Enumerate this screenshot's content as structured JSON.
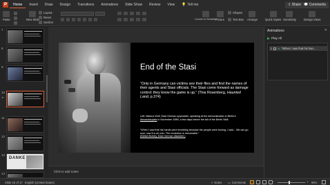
{
  "menubar": {
    "items": [
      "Home",
      "Insert",
      "Draw",
      "Design",
      "Transitions",
      "Animations",
      "Slide Show",
      "Review",
      "View"
    ],
    "active": "Home",
    "tell_me": "Tell me",
    "share": "Share",
    "comments": "Comments"
  },
  "ribbon": {
    "paste": "Paste",
    "new_slide": "New Slide",
    "layout": "Layout",
    "reset": "Reset",
    "section": "Section",
    "convert_smartart": "Convert to SmartArt",
    "picture": "Picture",
    "shapes": "Shapes",
    "text_box": "Text Box",
    "arrange": "Arrange",
    "quick_styles": "Quick Styles",
    "sensitivity": "Sensitivity",
    "design_ideas": "Design Ideas"
  },
  "thumbnails": [
    {
      "num": "7",
      "style": "dark"
    },
    {
      "num": "8",
      "style": "dark"
    },
    {
      "num": "9",
      "style": "dark"
    },
    {
      "num": "10",
      "style": "selected"
    },
    {
      "num": "11",
      "style": "dark"
    },
    {
      "num": "12",
      "style": "dark"
    },
    {
      "num": "13",
      "style": "light"
    },
    {
      "num": "14",
      "style": "dark"
    }
  ],
  "thumb_banner": "DANKE",
  "slide": {
    "title": "End of the Stasi",
    "body_main": "“Only in Germany can victims see their files and find the names of their agents and Stasi officials. The Stasi come forward as damage control: they know the game is up.” (Tina Rosenberg, ",
    "body_italic": "Haunted Land",
    "body_end": ", p.374)",
    "caption_a": "Left: Markus Wolf, East German spymaster, speaking at the demonstration in Berlin's ",
    "caption_link": "Alexanderplatz",
    "caption_b": " in November 1989, a few days before the fall of the Berlin Wall.",
    "quote": "“When I saw that his hands were trembling because the people were booing, I said... We can go now; now it is all over. The revolution is irreversible.”",
    "quote_source": "(Bärbel Bohley, East German dissident.)"
  },
  "notes_placeholder": "Click to add notes",
  "animations": {
    "title": "Animations",
    "play_all": "Play All",
    "entry_num": "1",
    "entry_text": "“When I saw that his han..."
  },
  "status": {
    "slide": "Slide 10 of 17",
    "language": "English (United States)",
    "notes": "Notes",
    "comments": "Comments",
    "zoom": "96%"
  },
  "colors": {
    "accent": "#e0613a",
    "play": "#3aa655",
    "background": "#1f1f1f"
  }
}
